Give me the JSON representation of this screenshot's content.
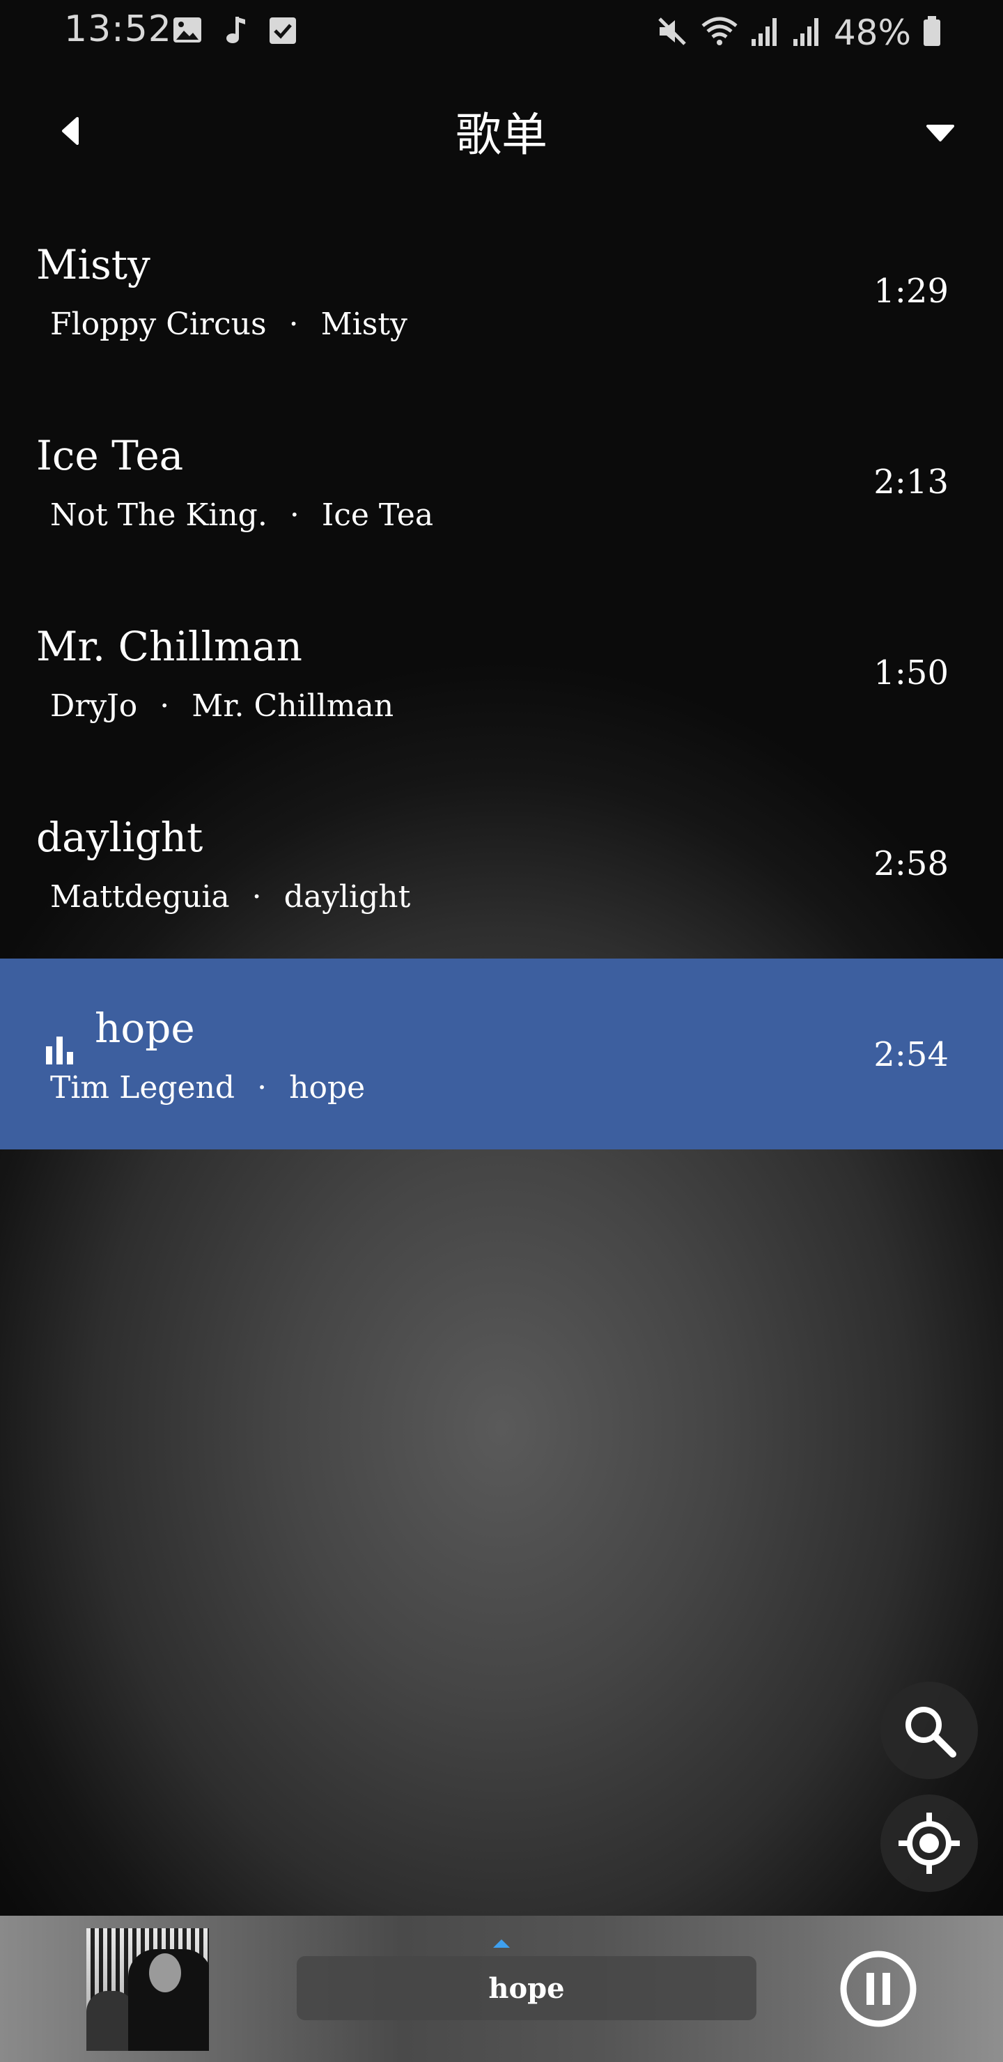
{
  "status_bar": {
    "time": "13:52",
    "battery": "48%",
    "left_icons": [
      "image-icon",
      "music-note-icon",
      "checkbox-icon"
    ],
    "right_icons": [
      "mute-icon",
      "wifi-icon",
      "signal-icon",
      "signal-icon",
      "battery-icon"
    ]
  },
  "header": {
    "title": "歌单",
    "back_icon": "back-arrow-icon",
    "menu_icon": "dropdown-icon"
  },
  "songs": [
    {
      "title": "Misty",
      "artist": "Floppy Circus",
      "album": "Misty",
      "separator": "·",
      "duration": "1:29",
      "playing": false
    },
    {
      "title": "Ice Tea",
      "artist": "Not The King.",
      "album": "Ice Tea",
      "separator": "·",
      "duration": "2:13",
      "playing": false
    },
    {
      "title": "Mr. Chillman",
      "artist": "DryJo",
      "album": "Mr. Chillman",
      "separator": "·",
      "duration": "1:50",
      "playing": false
    },
    {
      "title": "daylight",
      "artist": "Mattdeguia",
      "album": "daylight",
      "separator": "·",
      "duration": "2:58",
      "playing": false
    },
    {
      "title": "hope",
      "artist": "Tim Legend",
      "album": "hope",
      "separator": "·",
      "duration": "2:54",
      "playing": true
    }
  ],
  "fabs": {
    "search_icon": "search-icon",
    "locate_icon": "locate-icon"
  },
  "player": {
    "now_playing": "hope",
    "state": "playing",
    "control_icon": "pause-icon"
  },
  "colors": {
    "active_row": "#3d5f9f",
    "accent_indicator": "#3ea0f0"
  }
}
